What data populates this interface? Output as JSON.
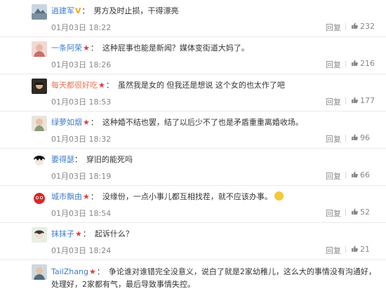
{
  "comments": [
    {
      "user": "逍建军",
      "badge": "V",
      "text": "男方及时止损，干得漂亮",
      "time": "01月03日 18:22",
      "reply": "回复",
      "likes": "232"
    },
    {
      "user": "一条阿荣",
      "badge": "★",
      "text": "这种屁事也能是新闻？媒体变街道大妈了。",
      "time": "01月03日 18:26",
      "reply": "回复",
      "likes": "216"
    },
    {
      "user": "每天都很好吃",
      "badge": "★",
      "text": "虽然我是女的 但我还是想说 这个女的也太作了吧",
      "time": "01月03日 18:53",
      "reply": "回复",
      "likes": "177"
    },
    {
      "user": "绿萝如烟",
      "badge": "★",
      "text": "这种婚不结也罢，结了以后少不了也是矛盾重重离婚收场。",
      "time": "01月03日 18:32",
      "reply": "回复",
      "likes": "96"
    },
    {
      "user": "要得瑟",
      "badge": "",
      "text": "穿旧的能死吗",
      "time": "01月03日 18:19",
      "reply": "回复",
      "likes": "66"
    },
    {
      "user": "城市飘由",
      "badge": "★",
      "text": "没缘份，一点小事儿都互相找茬，就不应该办事。",
      "time": "01月03日 18:54",
      "reply": "回复",
      "likes": "52"
    },
    {
      "user": "抹抹子",
      "badge": "★",
      "text": "起诉什么？",
      "time": "01月03日 18:24",
      "reply": "回复",
      "likes": "21"
    },
    {
      "user": "TailZhang",
      "badge": "★",
      "text": "争论谁对谁错完全没意义，说白了就是2家幼稚儿，这么大的事情没有沟通好，处理好，2家都有气，最后导致事情失控。",
      "time": "",
      "reply": "",
      "likes": ""
    }
  ],
  "colors": {
    "username": "#eb7350",
    "username_alt": "#3f7ecb",
    "vip": "#f7a51c",
    "star": "#e4393c",
    "meta": "#888888"
  },
  "icons": {
    "like": "thumbs-up-icon",
    "emoji": "smile-emoji-icon"
  }
}
